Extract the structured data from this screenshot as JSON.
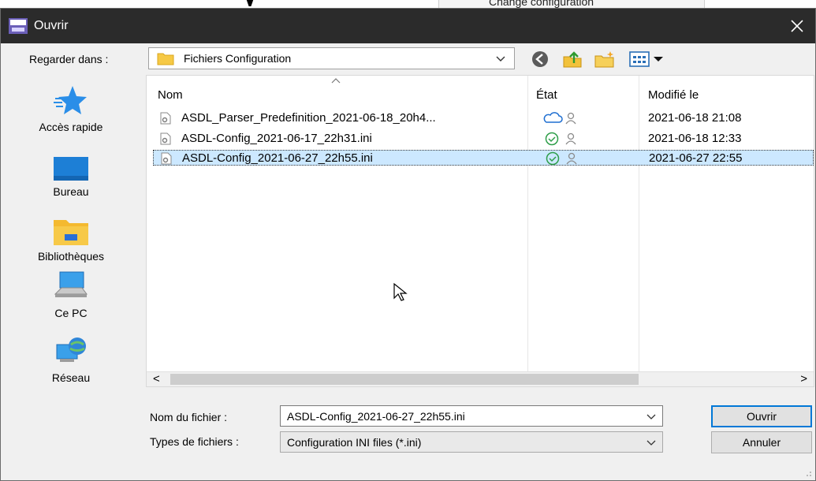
{
  "background": {
    "text": "Change configuration"
  },
  "window": {
    "title": "Ouvrir",
    "close_glyph": "✕",
    "app_icon": "app-icon",
    "title_bar_color": "#2b2b2b"
  },
  "look_in": {
    "label": "Regarder dans :",
    "value": "Fichiers Configuration"
  },
  "toolbar": {
    "icons": [
      "back-icon",
      "up-folder-icon",
      "new-folder-icon",
      "view-menu-icon"
    ]
  },
  "places": [
    {
      "label": "Accès rapide",
      "icon": "star-icon"
    },
    {
      "label": "Bureau",
      "icon": "desktop-icon"
    },
    {
      "label": "Bibliothèques",
      "icon": "library-icon"
    },
    {
      "label": "Ce PC",
      "icon": "computer-icon"
    },
    {
      "label": "Réseau",
      "icon": "network-icon"
    }
  ],
  "file_list": {
    "columns": [
      "Nom",
      "État",
      "Modifié le"
    ],
    "sort_glyph": "︿",
    "rows": [
      {
        "name": "ASDL_Parser_Predefinition_2021-06-18_20h4...",
        "status": "cloud",
        "modified": "2021-06-18 21:08",
        "selected": false
      },
      {
        "name": "ASDL-Config_2021-06-17_22h31.ini",
        "status": "synced",
        "modified": "2021-06-18 12:33",
        "selected": false
      },
      {
        "name": "ASDL-Config_2021-06-27_22h55.ini",
        "status": "synced",
        "modified": "2021-06-27 22:55",
        "selected": true
      }
    ],
    "scroll_left": "<",
    "scroll_right": ">"
  },
  "file_name": {
    "label": "Nom du fichier :",
    "value": "ASDL-Config_2021-06-27_22h55.ini"
  },
  "file_type": {
    "label": "Types de fichiers :",
    "value": "Configuration INI files (*.ini)"
  },
  "buttons": {
    "open": "Ouvrir",
    "cancel": "Annuler"
  },
  "colors": {
    "selection": "#cce8ff",
    "accent": "#0078d7",
    "status_ok": "#2e9e49",
    "status_cloud": "#1f6fd1"
  }
}
